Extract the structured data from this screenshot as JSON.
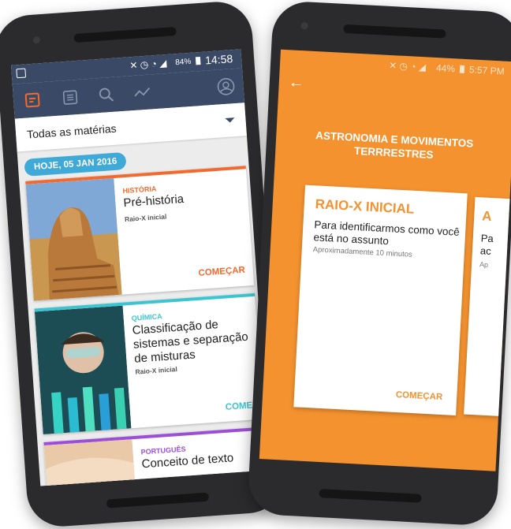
{
  "left_phone": {
    "status": {
      "time": "14:58",
      "battery": "84%"
    },
    "filter": {
      "value": "Todas as matérias"
    },
    "date_badge": "HOJE, 05 JAN 2016",
    "cards": [
      {
        "subject": "HISTÓRIA",
        "title": "Pré-história",
        "subtitle": "Raio-X inicial",
        "action": "COMEÇAR",
        "color": "#f26a2e"
      },
      {
        "subject": "QUÍMICA",
        "title": "Classificação de sistemas e separação de misturas",
        "subtitle": "Raio-X inicial",
        "action": "COMEÇA",
        "color": "#3cc5d0"
      },
      {
        "subject": "PORTUGUÊS",
        "title": "Conceito de texto",
        "color": "#9b4fd6"
      }
    ]
  },
  "right_phone": {
    "status": {
      "time": "5:57 PM",
      "battery": "44%"
    },
    "heading": "ASTRONOMIA E MOVIMENTOS TERRRESTRES",
    "card": {
      "title": "RAIO-X INICIAL",
      "description": "Para identificarmos como você está no assunto",
      "meta": "Aproximadamente 10 minutos",
      "action": "COMEÇAR"
    },
    "peek_card": {
      "title": "A",
      "line1": "Pa",
      "line2": "ac",
      "meta": "Ap"
    },
    "accent": "#f4922f"
  }
}
